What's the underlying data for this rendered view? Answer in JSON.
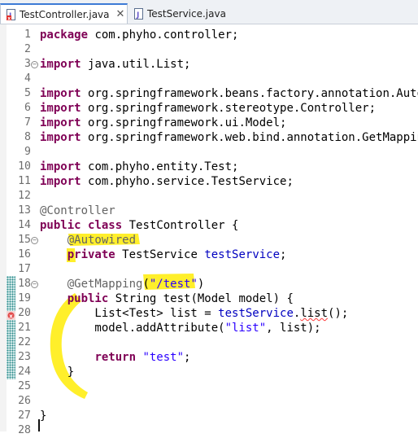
{
  "tabs": [
    {
      "label": "TestController.java",
      "close_label": "✕",
      "active": true
    },
    {
      "label": "TestService.java",
      "active": false
    }
  ],
  "lines": [
    {
      "n": "1",
      "code": [
        [
          "kw",
          "package"
        ],
        [
          "",
          "com.phyho.controller;"
        ]
      ]
    },
    {
      "n": "2",
      "code": []
    },
    {
      "n": "3",
      "fold": "⊖",
      "code": [
        [
          "kw",
          "import"
        ],
        [
          "",
          "java.util.List;"
        ]
      ]
    },
    {
      "n": "4",
      "code": []
    },
    {
      "n": "5",
      "code": [
        [
          "kw",
          "import"
        ],
        [
          "",
          "org.springframework.beans.factory.annotation.Autowi"
        ]
      ]
    },
    {
      "n": "6",
      "code": [
        [
          "kw",
          "import"
        ],
        [
          "",
          "org.springframework.stereotype.Controller;"
        ]
      ]
    },
    {
      "n": "7",
      "code": [
        [
          "kw",
          "import"
        ],
        [
          "",
          "org.springframework.ui.Model;"
        ]
      ]
    },
    {
      "n": "8",
      "code": [
        [
          "kw",
          "import"
        ],
        [
          "",
          "org.springframework.web.bind.annotation.GetMapping;"
        ]
      ]
    },
    {
      "n": "9",
      "code": []
    },
    {
      "n": "10",
      "code": [
        [
          "kw",
          "import"
        ],
        [
          "",
          "com.phyho.entity.Test;"
        ]
      ]
    },
    {
      "n": "11",
      "code": [
        [
          "kw",
          "import"
        ],
        [
          "",
          "com.phyho.service.TestService;"
        ]
      ]
    },
    {
      "n": "12",
      "code": []
    },
    {
      "n": "13",
      "code": [
        [
          "ann",
          "@Controller"
        ]
      ]
    },
    {
      "n": "14",
      "code": [
        [
          "kw",
          "public"
        ],
        [
          "kw",
          "class"
        ],
        [
          "",
          "TestController {"
        ]
      ]
    },
    {
      "n": "15",
      "fold": "⊖",
      "code": [
        [
          "",
          "    "
        ],
        [
          "ann",
          "@Autowired"
        ]
      ]
    },
    {
      "n": "16",
      "code": [
        [
          "",
          "    "
        ],
        [
          "kw",
          "private"
        ],
        [
          "",
          "TestService "
        ],
        [
          "fld",
          "testService"
        ],
        [
          "",
          ";"
        ]
      ]
    },
    {
      "n": "17",
      "code": []
    },
    {
      "n": "18",
      "fold": "⊖",
      "code": [
        [
          "",
          "    "
        ],
        [
          "ann",
          "@GetMapping"
        ],
        [
          "",
          "("
        ],
        [
          "str",
          "\"/test\""
        ],
        [
          "",
          ")"
        ]
      ]
    },
    {
      "n": "19",
      "code": [
        [
          "",
          "    "
        ],
        [
          "kw",
          "public"
        ],
        [
          "",
          "String test(Model model) {"
        ]
      ]
    },
    {
      "n": "20",
      "code": [
        [
          "",
          "        List<Test> list = "
        ],
        [
          "fld",
          "testService"
        ],
        [
          "",
          "."
        ],
        [
          "err",
          "list"
        ],
        [
          "",
          "();"
        ]
      ]
    },
    {
      "n": "21",
      "code": [
        [
          "",
          "        model.addAttribute("
        ],
        [
          "str",
          "\"list\""
        ],
        [
          "",
          ", list);"
        ]
      ]
    },
    {
      "n": "22",
      "code": []
    },
    {
      "n": "23",
      "code": [
        [
          "",
          "        "
        ],
        [
          "kw",
          "return"
        ],
        [
          "str",
          "\"test\""
        ],
        [
          "",
          ";"
        ]
      ]
    },
    {
      "n": "24",
      "code": [
        [
          "",
          "    }"
        ]
      ]
    },
    {
      "n": "25",
      "code": []
    },
    {
      "n": "26",
      "code": []
    },
    {
      "n": "27",
      "code": [
        [
          "",
          "}"
        ]
      ]
    },
    {
      "n": "28",
      "code": []
    }
  ],
  "colors": {
    "keyword": "#7f0055",
    "annotation": "#646464",
    "string": "#2a00ff",
    "field": "#0000c0",
    "highlight": "#ffef2b",
    "change_bar": "#2e8c8c"
  },
  "icons": [
    "java-file-icon",
    "error-marker-icon",
    "fold-toggle-icon"
  ]
}
